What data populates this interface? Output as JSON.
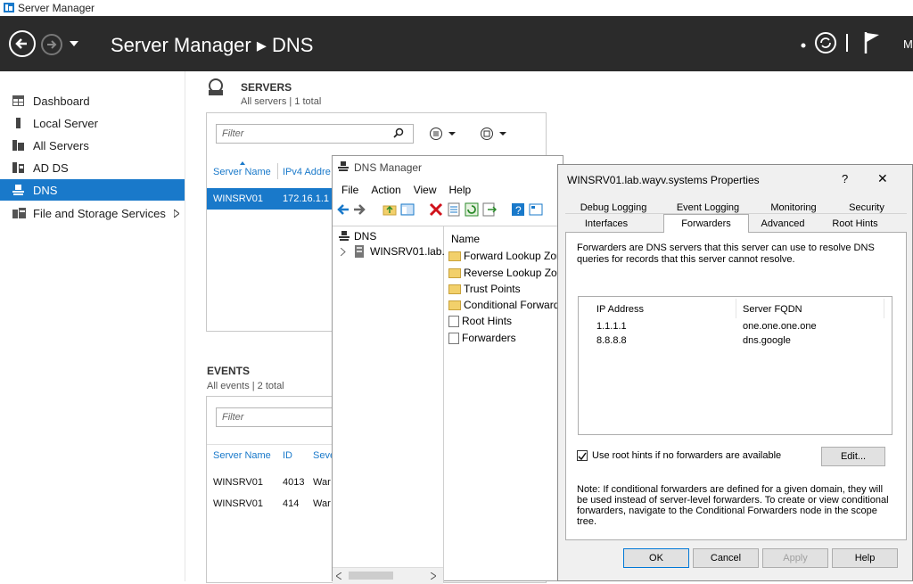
{
  "window": {
    "title": "Server Manager"
  },
  "header": {
    "breadcrumb": "Server Manager ▸ DNS",
    "manage_label": "M"
  },
  "sidebar": {
    "items": [
      {
        "label": "Dashboard"
      },
      {
        "label": "Local Server"
      },
      {
        "label": "All Servers"
      },
      {
        "label": "AD DS"
      },
      {
        "label": "DNS"
      },
      {
        "label": "File and Storage Services"
      }
    ]
  },
  "servers": {
    "title": "SERVERS",
    "subtitle": "All servers | 1 total",
    "filter_placeholder": "Filter",
    "columns": [
      "Server Name",
      "IPv4 Addre"
    ],
    "rows": [
      {
        "name": "WINSRV01",
        "ip": "172.16.1.1"
      }
    ]
  },
  "events": {
    "title": "EVENTS",
    "subtitle": "All events | 2 total",
    "filter_placeholder": "Filter",
    "columns": [
      "Server Name",
      "ID",
      "Seve"
    ],
    "rows": [
      {
        "name": "WINSRV01",
        "id": "4013",
        "sev": "War"
      },
      {
        "name": "WINSRV01",
        "id": "414",
        "sev": "War"
      }
    ]
  },
  "dns_manager": {
    "title": "DNS Manager",
    "menu": [
      "File",
      "Action",
      "View",
      "Help"
    ],
    "tree_root": "DNS",
    "tree_child": "WINSRV01.lab.",
    "list_header": "Name",
    "items": [
      "Forward Lookup Zon",
      "Reverse Lookup Zon",
      "Trust Points",
      "Conditional Forwarde",
      "Root Hints",
      "Forwarders"
    ]
  },
  "properties": {
    "title": "WINSRV01.lab.wayv.systems Properties",
    "help_glyph": "?",
    "close_glyph": "✕",
    "tabs_row1": [
      "Debug Logging",
      "Event Logging",
      "Monitoring",
      "Security"
    ],
    "tabs_row2": [
      "Interfaces",
      "Forwarders",
      "Advanced",
      "Root Hints"
    ],
    "description": "Forwarders are DNS servers that this server can use to resolve DNS queries for records that this server cannot resolve.",
    "table_columns": [
      "IP Address",
      "Server FQDN"
    ],
    "forwarders": [
      {
        "ip": "1.1.1.1",
        "fqdn": "one.one.one.one"
      },
      {
        "ip": "8.8.8.8",
        "fqdn": "dns.google"
      }
    ],
    "use_root_hints_label": "Use root hints if no forwarders are available",
    "use_root_hints_checked": true,
    "edit_button": "Edit...",
    "note": "Note: If conditional forwarders are defined for a given domain, they will be used instead of server-level forwarders.  To create or view conditional forwarders, navigate to the Conditional Forwarders node in the scope tree.",
    "buttons": {
      "ok": "OK",
      "cancel": "Cancel",
      "apply": "Apply",
      "help": "Help"
    }
  },
  "colors": {
    "accent": "#1979ca",
    "header_bg": "#2b2b2b"
  }
}
